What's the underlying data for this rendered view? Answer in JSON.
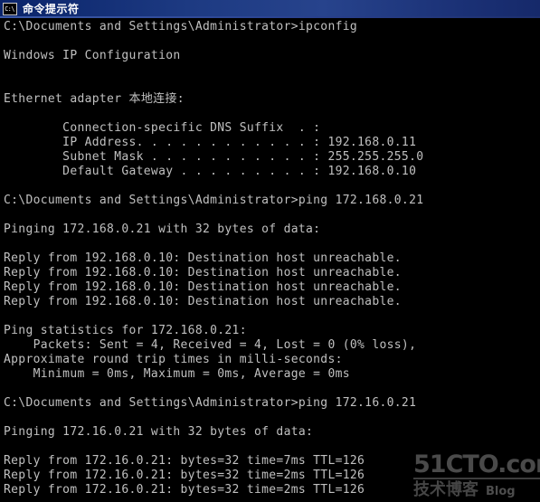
{
  "window": {
    "title": "命令提示符",
    "icon": "command-prompt-icon",
    "icon_glyph": "C:\\",
    "titlebar_color": "#0a246a",
    "background_color": "#000000",
    "text_color": "#c0c0c0"
  },
  "console": {
    "lines": [
      "C:\\Documents and Settings\\Administrator>ipconfig",
      "",
      "Windows IP Configuration",
      "",
      "",
      "Ethernet adapter 本地连接:",
      "",
      "        Connection-specific DNS Suffix  . :",
      "        IP Address. . . . . . . . . . . . : 192.168.0.11",
      "        Subnet Mask . . . . . . . . . . . : 255.255.255.0",
      "        Default Gateway . . . . . . . . . : 192.168.0.10",
      "",
      "C:\\Documents and Settings\\Administrator>ping 172.168.0.21",
      "",
      "Pinging 172.168.0.21 with 32 bytes of data:",
      "",
      "Reply from 192.168.0.10: Destination host unreachable.",
      "Reply from 192.168.0.10: Destination host unreachable.",
      "Reply from 192.168.0.10: Destination host unreachable.",
      "Reply from 192.168.0.10: Destination host unreachable.",
      "",
      "Ping statistics for 172.168.0.21:",
      "    Packets: Sent = 4, Received = 4, Lost = 0 (0% loss),",
      "Approximate round trip times in milli-seconds:",
      "    Minimum = 0ms, Maximum = 0ms, Average = 0ms",
      "",
      "C:\\Documents and Settings\\Administrator>ping 172.16.0.21",
      "",
      "Pinging 172.16.0.21 with 32 bytes of data:",
      "",
      "Reply from 172.16.0.21: bytes=32 time=7ms TTL=126",
      "Reply from 172.16.0.21: bytes=32 time=2ms TTL=126",
      "Reply from 172.16.0.21: bytes=32 time=2ms TTL=126"
    ]
  },
  "watermark": {
    "main": "51CTO.com",
    "sub_cn": "技术博客",
    "sub_en": "Blog",
    "color": "#4a4a4a"
  }
}
